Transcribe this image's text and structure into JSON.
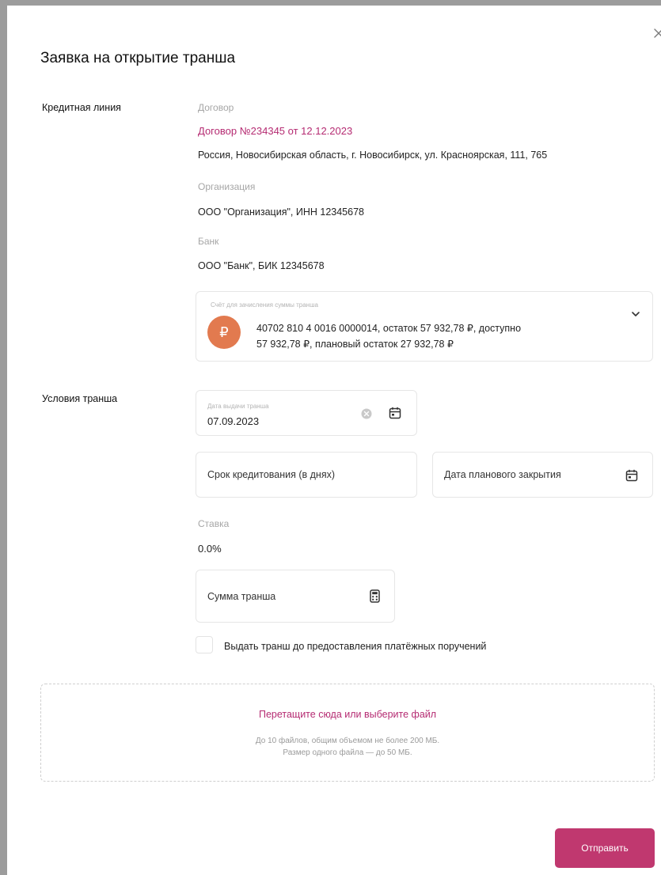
{
  "dialog": {
    "title": "Заявка на открытие транша",
    "close_icon": "close-icon"
  },
  "credit_line": {
    "section_label": "Кредитная линия",
    "contract_label": "Договор",
    "contract_link": "Договор №234345 от 12.12.2023",
    "address": "Россия, Новосибирская область, г. Новосибирск, ул. Красноярская, 111, 765",
    "organization_label": "Организация",
    "organization_value": "ООО \"Организация\", ИНН 12345678",
    "bank_label": "Банк",
    "bank_value": "ООО \"Банк\", БИК 12345678",
    "account": {
      "caption": "Счёт для зачисления суммы транша",
      "avatar_symbol": "₽",
      "line1": "40702 810 4 0016 0000014, остаток 57 932,78 ₽, доступно",
      "line2": "57 932,78 ₽, плановый остаток 27 932,78 ₽",
      "accent_color": "#e27a4f"
    }
  },
  "tranche_terms": {
    "section_label": "Условия транша",
    "issue_date": {
      "label": "Дата выдачи транша",
      "value": "07.09.2023"
    },
    "term_placeholder": "Срок кредитования (в днях)",
    "planned_close_placeholder": "Дата планового закрытия",
    "rate_label": "Ставка",
    "rate_value": "0.0%",
    "amount_placeholder": "Сумма транша",
    "checkbox_label": "Выдать транш до предоставления платёжных поручений",
    "checkbox_checked": false
  },
  "upload": {
    "title": "Перетащите сюда или выберите файл",
    "note_line1": "До 10 файлов, общим объемом не более 200 МБ.",
    "note_line2": "Размер одного файла — до 50 МБ."
  },
  "actions": {
    "submit_label": "Отправить",
    "brand_color": "#c0386f"
  }
}
